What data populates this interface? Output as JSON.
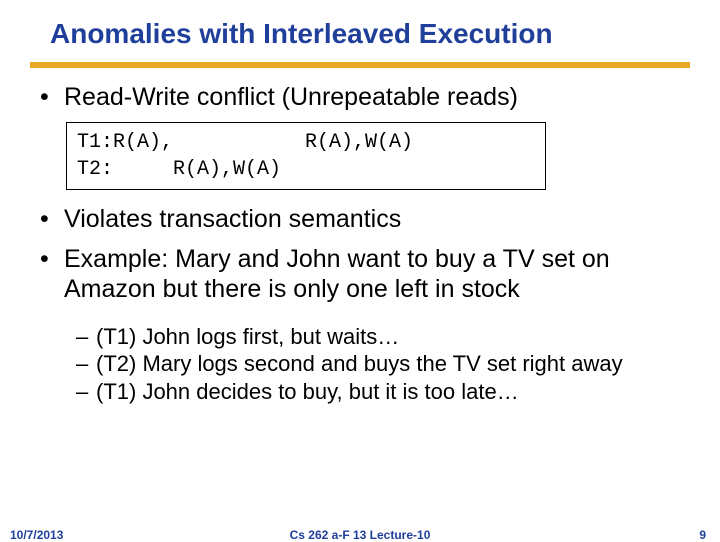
{
  "title": "Anomalies with Interleaved Execution",
  "bullets": {
    "b1": "Read-Write conflict (Unrepeatable reads)",
    "b2": "Violates transaction semantics",
    "b3": "Example: Mary and John want to buy a TV set on Amazon but there is only one left in stock"
  },
  "code": {
    "line1": "T1:R(A),           R(A),W(A)",
    "line2": "T2:     R(A),W(A)"
  },
  "subs": {
    "s1": "(T1) John logs first, but waits…",
    "s2": "(T2) Mary logs second and buys the TV set right away",
    "s3": "(T1) John decides to buy, but it is too late…"
  },
  "footer": {
    "date": "10/7/2013",
    "mid": "Cs 262 a-F 13 Lecture-10",
    "page": "9"
  }
}
